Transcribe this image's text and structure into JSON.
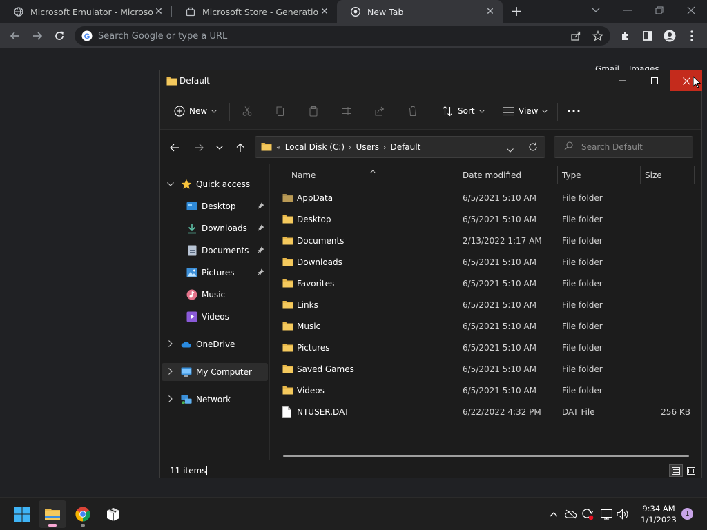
{
  "browser": {
    "tabs": [
      {
        "title": "Microsoft Emulator - Microsoft St",
        "active": false
      },
      {
        "title": "Microsoft Store - Generation Proj",
        "active": false
      },
      {
        "title": "New Tab",
        "active": true
      }
    ],
    "omnibox_placeholder": "Search Google or type a URL",
    "page_links": [
      "Gmail",
      "Images"
    ]
  },
  "explorer": {
    "title": "Default",
    "command_bar": {
      "new_label": "New",
      "sort_label": "Sort",
      "view_label": "View"
    },
    "address": {
      "prefix": "«",
      "crumbs": [
        "Local Disk (C:)",
        "Users",
        "Default"
      ]
    },
    "search_placeholder": "Search Default",
    "nav_pane": {
      "quick_access": "Quick access",
      "pinned": [
        "Desktop",
        "Downloads",
        "Documents",
        "Pictures"
      ],
      "unpinned": [
        "Music",
        "Videos"
      ],
      "onedrive": "OneDrive",
      "my_computer": "My Computer",
      "network": "Network"
    },
    "columns": {
      "name": "Name",
      "date": "Date modified",
      "type": "Type",
      "size": "Size"
    },
    "rows": [
      {
        "name": "AppData",
        "date": "6/5/2021 5:10 AM",
        "type": "File folder",
        "size": ""
      },
      {
        "name": "Desktop",
        "date": "6/5/2021 5:10 AM",
        "type": "File folder",
        "size": ""
      },
      {
        "name": "Documents",
        "date": "2/13/2022 1:17 AM",
        "type": "File folder",
        "size": ""
      },
      {
        "name": "Downloads",
        "date": "6/5/2021 5:10 AM",
        "type": "File folder",
        "size": ""
      },
      {
        "name": "Favorites",
        "date": "6/5/2021 5:10 AM",
        "type": "File folder",
        "size": ""
      },
      {
        "name": "Links",
        "date": "6/5/2021 5:10 AM",
        "type": "File folder",
        "size": ""
      },
      {
        "name": "Music",
        "date": "6/5/2021 5:10 AM",
        "type": "File folder",
        "size": ""
      },
      {
        "name": "Pictures",
        "date": "6/5/2021 5:10 AM",
        "type": "File folder",
        "size": ""
      },
      {
        "name": "Saved Games",
        "date": "6/5/2021 5:10 AM",
        "type": "File folder",
        "size": ""
      },
      {
        "name": "Videos",
        "date": "6/5/2021 5:10 AM",
        "type": "File folder",
        "size": ""
      },
      {
        "name": "NTUSER.DAT",
        "date": "6/22/2022 4:32 PM",
        "type": "DAT File",
        "size": "256 KB"
      }
    ],
    "status": "11 items"
  },
  "taskbar": {
    "time": "9:34 AM",
    "date": "1/1/2023",
    "notifications": "1"
  },
  "colors": {
    "folder": "#e8b84a",
    "close_red": "#c42b1c",
    "accent": "#60cdff"
  }
}
